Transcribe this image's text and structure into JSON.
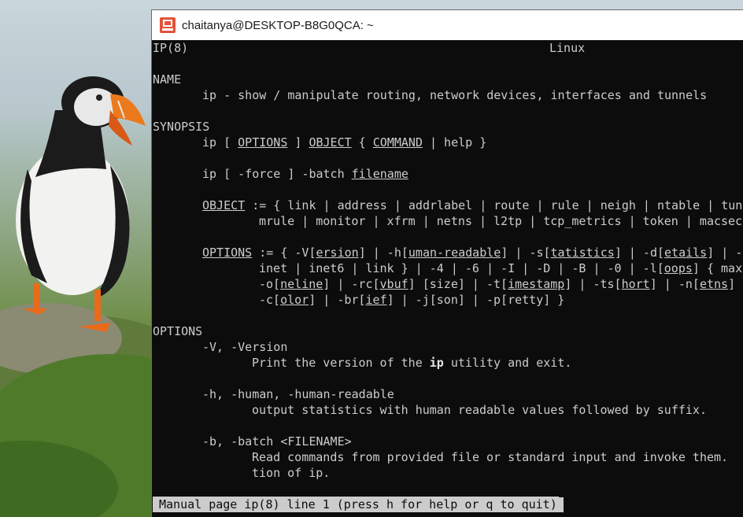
{
  "window": {
    "title": "chaitanya@DESKTOP-B8G0QCA: ~"
  },
  "man": {
    "header_left": "IP(8)",
    "header_center": "Linux",
    "sec_name": "NAME",
    "name_line": "ip - show / manipulate routing, network devices, interfaces and tunnels",
    "sec_synopsis": "SYNOPSIS",
    "syn1": {
      "a": "ip [ ",
      "b": "OPTIONS",
      "c": " ] ",
      "d": "OBJECT",
      "e": " { ",
      "f": "COMMAND",
      "g": " | help }"
    },
    "syn2": {
      "a": "ip [ -force ] -batch ",
      "b": "filename"
    },
    "syn3": {
      "a": "OBJECT",
      "b": " := { link | address | addrlabel | route | rule | neigh | ntable | tunn"
    },
    "syn4": "mrule | monitor | xfrm | netns | l2tp | tcp_metrics | token | macsec",
    "syn5": {
      "a": "OPTIONS",
      "b": " := { -V[",
      "c": "ersion",
      "d": "] | -h[",
      "e": "uman-readable",
      "f": "] | -s[",
      "g": "tatistics",
      "h": "] | -d[",
      "i": "etails",
      "j": "] | -r"
    },
    "syn6": {
      "a": "inet | inet6 | link } | -4 | -6 | -I | -D | -B | -0 | -l[",
      "b": "oops",
      "c": "] { maxi"
    },
    "syn7": {
      "a": "-o[",
      "b": "neline",
      "c": "] | -rc[",
      "d": "vbuf",
      "e": "] [size] | -t[",
      "f": "imestamp",
      "g": "] | -ts[",
      "h": "hort",
      "i": "] | -n[",
      "j": "etns",
      "k": "] n"
    },
    "syn8": {
      "a": "-c[",
      "b": "olor",
      "c": "] | -br[",
      "d": "ief",
      "e": "] | -j[son] | -p[retty] }"
    },
    "sec_options": "OPTIONS",
    "opt_v": "-V, -Version",
    "opt_v_desc": {
      "a": "Print the version of the ",
      "b": "ip",
      "c": " utility and exit."
    },
    "opt_h": "-h, -human, -human-readable",
    "opt_h_desc": "output statistics with human readable values followed by suffix.",
    "opt_b": "-b, -batch <FILENAME>",
    "opt_b_desc1": "Read commands from provided file or standard input and invoke them.  F",
    "opt_b_desc2": "tion of ip."
  },
  "status": "Manual page ip(8) line 1 (press h for help or q to quit)",
  "colors": {
    "terminal_bg": "#0c0c0c",
    "terminal_fg": "#cccccc",
    "titlebar_bg": "#ffffff",
    "icon_orange": "#e0533a"
  }
}
